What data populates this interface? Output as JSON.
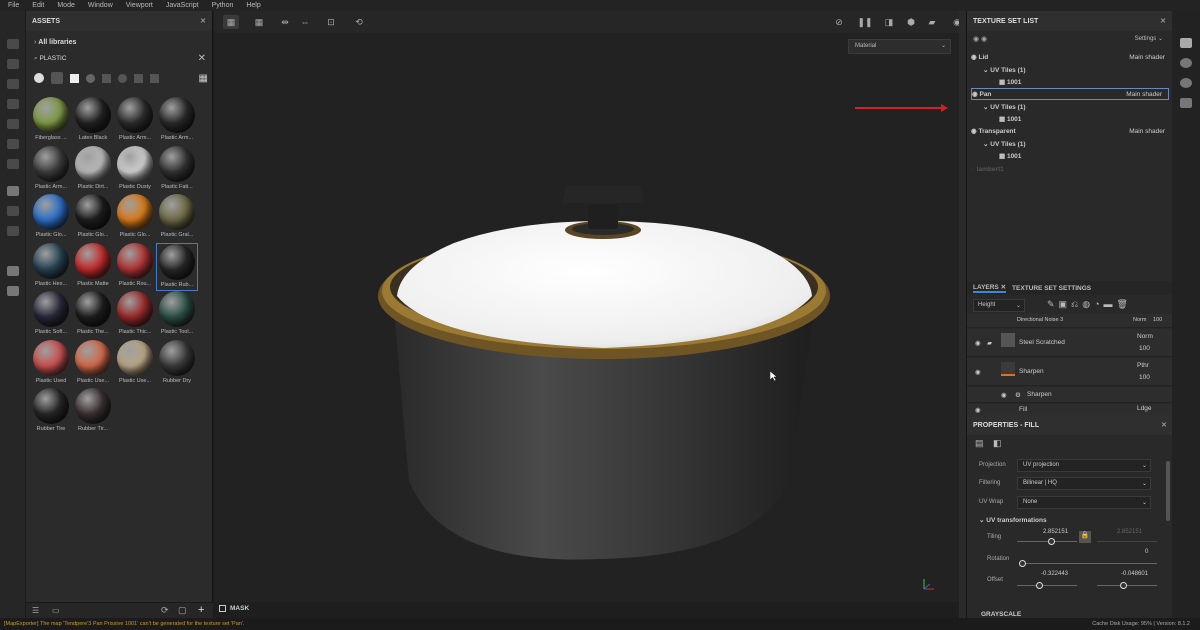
{
  "menu": [
    "File",
    "Edit",
    "Mode",
    "Window",
    "Viewport",
    "JavaScript",
    "Python",
    "Help"
  ],
  "assets": {
    "title": "ASSETS",
    "libraries_label": "All libraries",
    "search_value": "PLASTIC",
    "materials": [
      {
        "label": "Fiberglass ...",
        "color": "#7f9a46"
      },
      {
        "label": "Latex Black",
        "color": "#222222"
      },
      {
        "label": "Plastic Arm...",
        "color": "#2c2c2c"
      },
      {
        "label": "Plastic Arm...",
        "color": "#2a2a2a"
      },
      {
        "label": "Plastic Arm...",
        "color": "#3c3c3c"
      },
      {
        "label": "Plastic Dirt...",
        "color": "#b9b9b9"
      },
      {
        "label": "Plastic Dusty",
        "color": "#cfcfcf"
      },
      {
        "label": "Plastic Fati...",
        "color": "#323232"
      },
      {
        "label": "Plastic Glo...",
        "color": "#2c6fc8"
      },
      {
        "label": "Plastic Glo...",
        "color": "#1d1d1d"
      },
      {
        "label": "Plastic Glo...",
        "color": "#d97a1a"
      },
      {
        "label": "Plastic Gral...",
        "color": "#6d6a45"
      },
      {
        "label": "Plastic Hex...",
        "color": "#274454"
      },
      {
        "label": "Plastic Matte",
        "color": "#c22c2c"
      },
      {
        "label": "Plastic Rou...",
        "color": "#b13434"
      },
      {
        "label": "Plastic Rub...",
        "color": "#262626"
      },
      {
        "label": "Plastic Soft...",
        "color": "#28283a"
      },
      {
        "label": "Plastic The...",
        "color": "#1e1e1e"
      },
      {
        "label": "Plastic Thic...",
        "color": "#9a2a2a"
      },
      {
        "label": "Plastic Tool...",
        "color": "#2d5046"
      },
      {
        "label": "Plastic Used",
        "color": "#c95050"
      },
      {
        "label": "Plastic Use...",
        "color": "#d0694a"
      },
      {
        "label": "Plastic Use...",
        "color": "#b9a585"
      },
      {
        "label": "Rubber Dry",
        "color": "#3a3a3a"
      },
      {
        "label": "Rubber Tire",
        "color": "#262626"
      },
      {
        "label": "Rubber Tir...",
        "color": "#3a3030"
      }
    ]
  },
  "viewport": {
    "material_select": "Material",
    "mask_label": "MASK"
  },
  "texture_set_list": {
    "title": "TEXTURE SET LIST",
    "settings_label": "Settings",
    "sets": [
      {
        "name": "Lid",
        "shader": "Main shader",
        "uv": "UV Tiles (1)",
        "tile": "1001"
      },
      {
        "name": "Pan",
        "shader": "Main shader",
        "uv": "UV Tiles (1)",
        "tile": "1001"
      },
      {
        "name": "Transparent",
        "shader": "Main shader",
        "uv": "UV Tiles (1)",
        "tile": "1001"
      }
    ],
    "disabled_set": "lambert1"
  },
  "layers": {
    "tab_layers": "LAYERS",
    "tab_settings": "TEXTURE SET SETTINGS",
    "channel": "Height",
    "rows": [
      {
        "name": "Directional Noise 3",
        "blend": "Norm",
        "opacity": "100"
      },
      {
        "name": "Steel Scratched",
        "blend": "Norm",
        "opacity": "100"
      },
      {
        "name": "Sharpen",
        "blend": "Pthr",
        "opacity": "100"
      },
      {
        "name": "Sharpen",
        "blend": "",
        "opacity": ""
      },
      {
        "name": "Fill",
        "blend": "Ldge",
        "opacity": ""
      }
    ]
  },
  "properties": {
    "title": "PROPERTIES - FILL",
    "projection_label": "Projection",
    "projection_value": "UV projection",
    "filtering_label": "Filtering",
    "filtering_value": "Bilinear | HQ",
    "uvwrap_label": "UV Wrap",
    "uvwrap_value": "None",
    "uv_section": "UV transformations",
    "tiling_label": "Tiling",
    "tiling_value": "2.852151",
    "tiling_value2": "2.852151",
    "rotation_label": "Rotation",
    "rotation_value": "0",
    "offset_label": "Offset",
    "offset_x": "-0.322443",
    "offset_y": "-0.048601",
    "grayscale_label": "GRAYSCALE"
  },
  "status": {
    "message": "[MapExporter] The map 'Tendpere'3 Pan Prissive 1001' can't be generated for the texture set 'Pan'.",
    "cache": "Cache Disk Usage:  95%  |  Version: 8.1.2"
  }
}
